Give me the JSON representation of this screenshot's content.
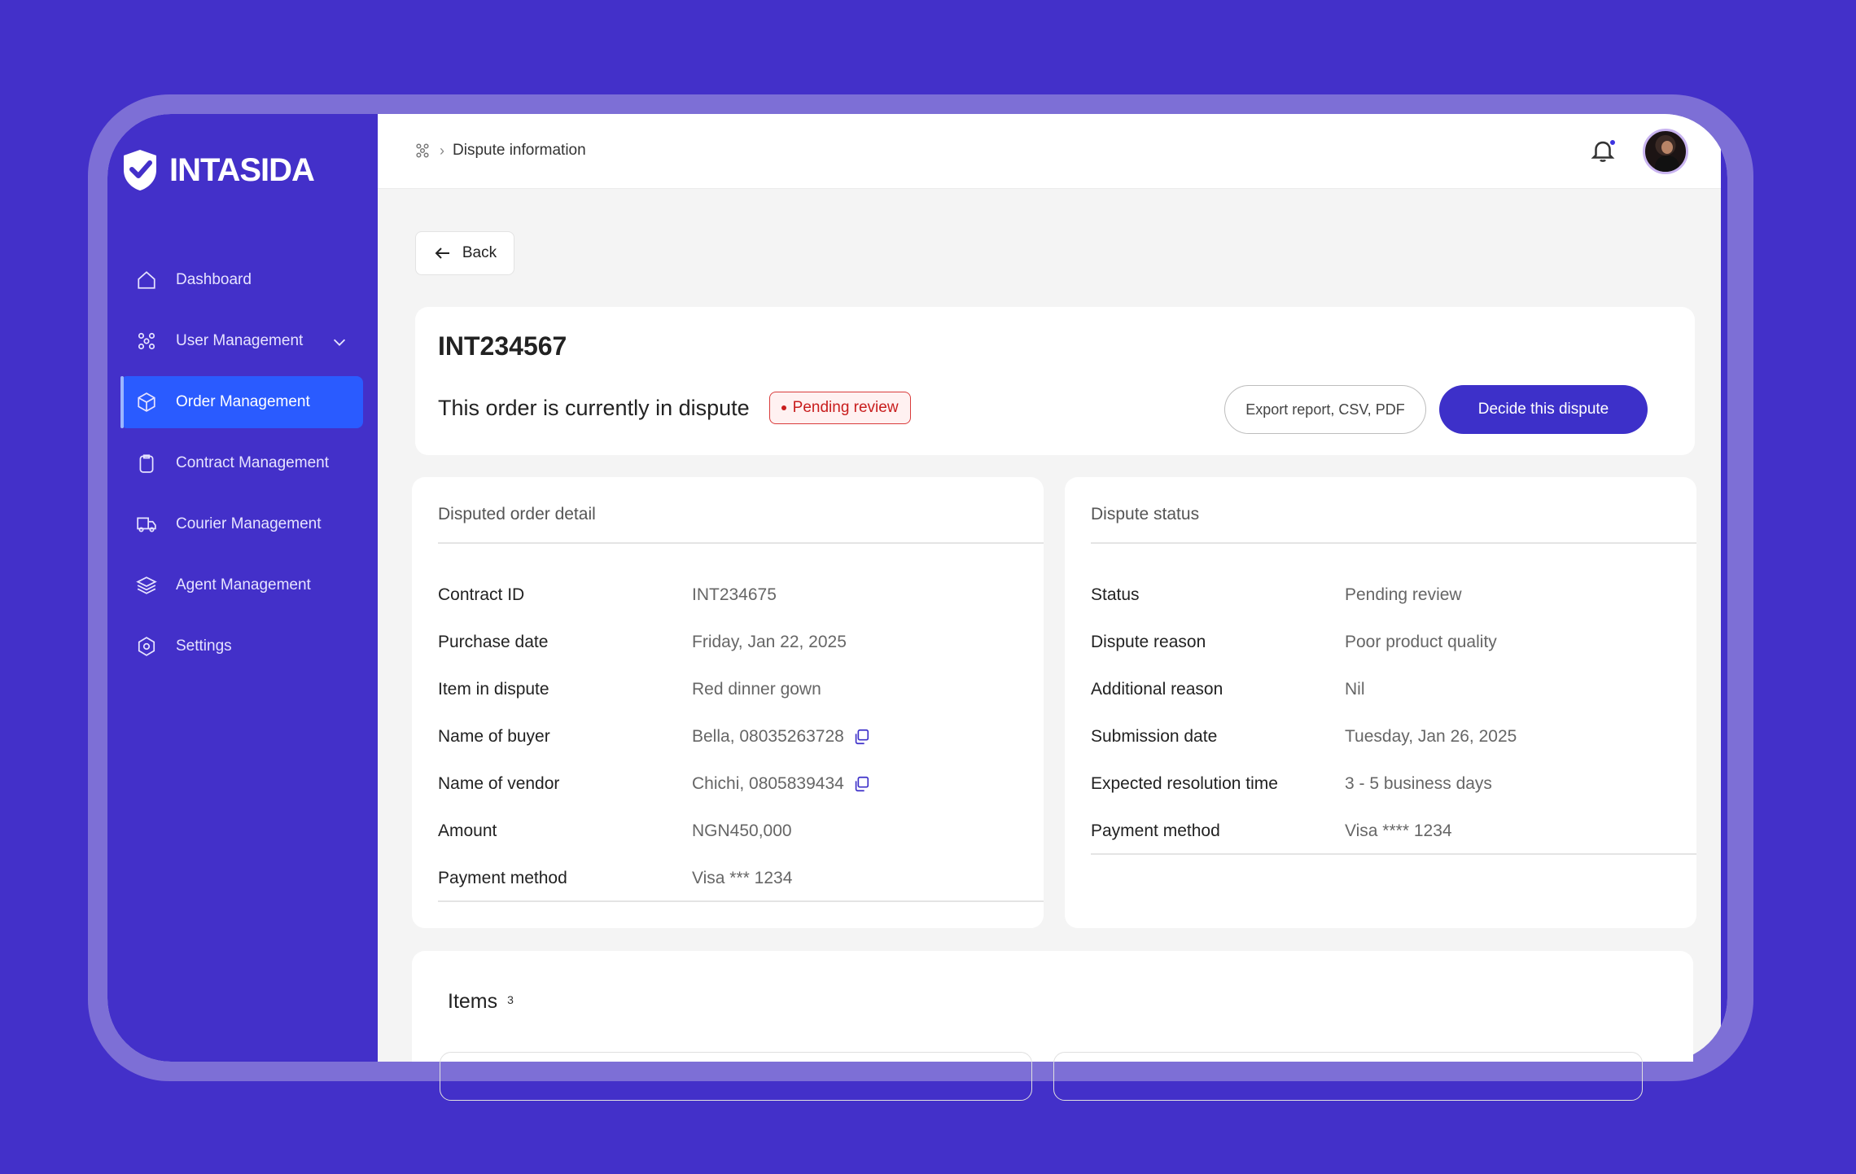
{
  "brand": {
    "name": "INTASIDA"
  },
  "sidebar": {
    "items": [
      {
        "label": "Dashboard",
        "icon": "home-icon"
      },
      {
        "label": "User Management",
        "icon": "users-icon"
      },
      {
        "label": "Order Management",
        "icon": "box-icon"
      },
      {
        "label": "Contract Management",
        "icon": "clipboard-icon"
      },
      {
        "label": "Courier Management",
        "icon": "truck-icon"
      },
      {
        "label": "Agent Management",
        "icon": "layers-icon"
      },
      {
        "label": "Settings",
        "icon": "gear-icon"
      }
    ]
  },
  "topbar": {
    "breadcrumb": "Dispute information"
  },
  "back_label": "Back",
  "order": {
    "id": "INT234567",
    "dispute_text": "This order is currently in dispute",
    "status_badge": "Pending review",
    "export_label": "Export report, CSV, PDF",
    "decide_label": "Decide this dispute"
  },
  "disputed_order": {
    "title": "Disputed order detail",
    "rows": [
      {
        "k": "Contract ID",
        "v": "INT234675"
      },
      {
        "k": "Purchase date",
        "v": "Friday, Jan 22, 2025"
      },
      {
        "k": "Item in dispute",
        "v": "Red dinner gown"
      },
      {
        "k": "Name of buyer",
        "v": "Bella, 08035263728"
      },
      {
        "k": "Name of vendor",
        "v": "Chichi, 0805839434"
      },
      {
        "k": "Amount",
        "v": "NGN450,000"
      },
      {
        "k": "Payment method",
        "v": "Visa *** 1234"
      }
    ]
  },
  "dispute_status": {
    "title": "Dispute status",
    "rows": [
      {
        "k": "Status",
        "v": "Pending review"
      },
      {
        "k": "Dispute reason",
        "v": "Poor product quality"
      },
      {
        "k": "Additional reason",
        "v": "Nil"
      },
      {
        "k": "Submission date",
        "v": "Tuesday, Jan 26, 2025"
      },
      {
        "k": "Expected resolution time",
        "v": "3 - 5 business days"
      },
      {
        "k": "Payment method",
        "v": "Visa **** 1234"
      }
    ]
  },
  "items": {
    "title": "Items",
    "count": "3"
  },
  "colors": {
    "primary": "#4330c9",
    "active": "#2a5bff",
    "danger": "#c81d1d"
  }
}
